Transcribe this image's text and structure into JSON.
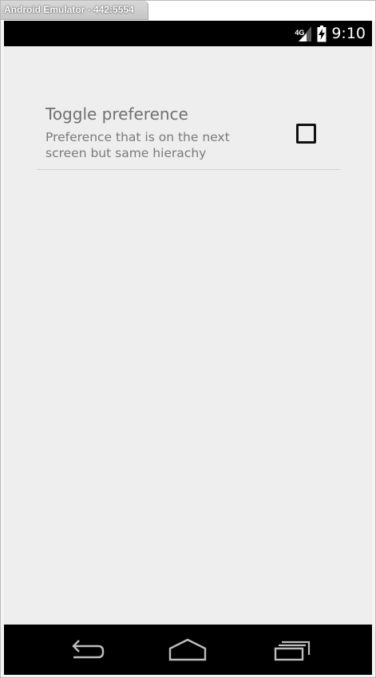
{
  "window": {
    "title": "Android Emulator - 442:5554"
  },
  "status_bar": {
    "network_type": "4G",
    "time": "9:10"
  },
  "preference": {
    "title": "Toggle preference",
    "summary": "Preference that is on the next screen but same hierachy",
    "checked": false
  },
  "nav_bar": {
    "buttons": [
      "back",
      "home",
      "recent-apps"
    ]
  },
  "colors": {
    "background": "#eeeeee",
    "status_bar": "#000000",
    "nav_bar": "#000000",
    "title_text": "#707070",
    "summary_text": "#7a7a7a",
    "divider": "#d2d2d2"
  }
}
